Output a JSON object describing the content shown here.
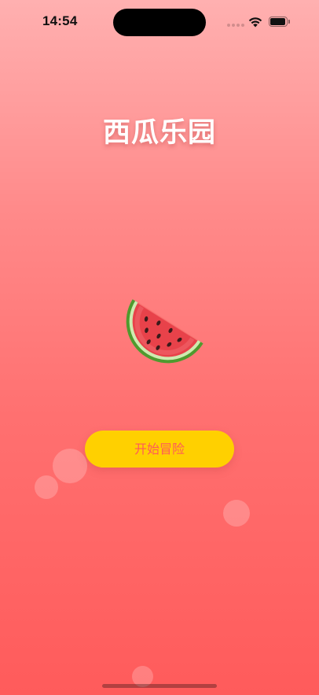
{
  "status_bar": {
    "time": "14:54",
    "icons": [
      "cellular-signal-icon",
      "wifi-icon",
      "battery-icon"
    ]
  },
  "title": "西瓜乐园",
  "mascot_icon": "watermelon-slice-icon",
  "start_button": {
    "label": "开始冒险",
    "background_color": "#ffd000",
    "text_color": "#ff5a5a"
  },
  "colors": {
    "background_top": "#ffb0b0",
    "background_bottom": "#ff5b5b"
  }
}
